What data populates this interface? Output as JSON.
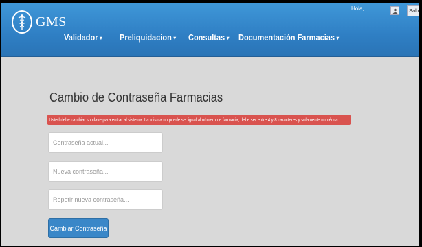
{
  "brand": {
    "name": "GMS",
    "logo_icon": "caduceus-icon"
  },
  "header": {
    "greeting": "Hola,",
    "user_icon": "user-icon",
    "logout_label": "Salir"
  },
  "nav": {
    "items": [
      {
        "label": "Validador"
      },
      {
        "label": "Preliquidacion"
      },
      {
        "label": "Consultas"
      },
      {
        "label": "Documentación Farmacias"
      }
    ]
  },
  "page": {
    "title": "Cambio de Contraseña Farmacias",
    "alert": "Usted debe cambiar su clave para entrar al sistema. La misma no puede ser igual al número de farmacia, debe ser entre 4 y 8 caracteres y solamente numérica"
  },
  "form": {
    "current_placeholder": "Contraseña actual...",
    "new_placeholder": "Nueva contraseña...",
    "repeat_placeholder": "Repetir nueva contraseña...",
    "submit_label": "Cambiar Contraseña"
  },
  "colors": {
    "navbar": "#2f7fc4",
    "alert": "#d9534f",
    "primary_button": "#3a87c8",
    "background": "#d9d9d9"
  }
}
